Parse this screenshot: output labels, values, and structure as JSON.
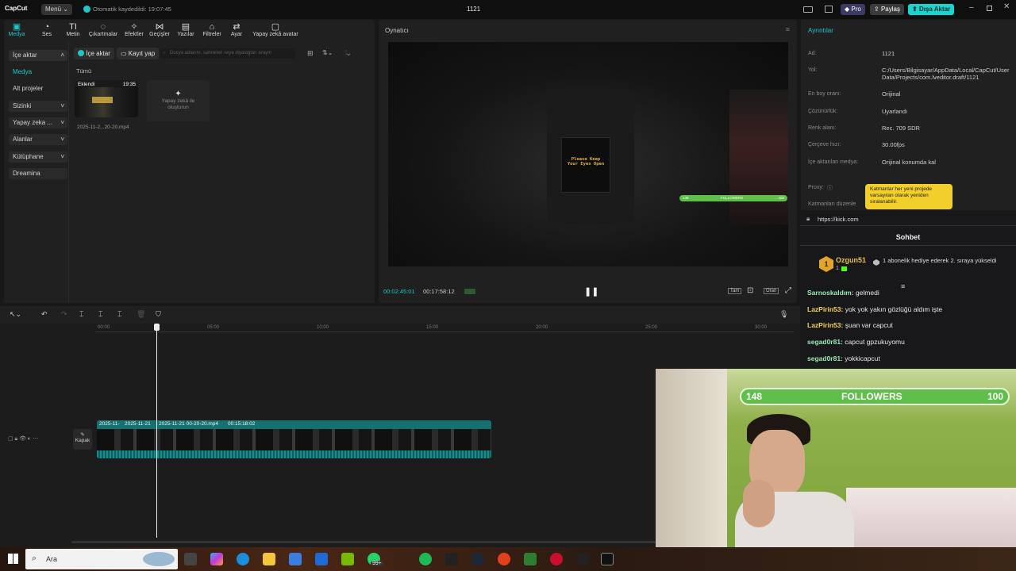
{
  "topbar": {
    "logo": "CapCut",
    "menu_label": "Menü",
    "autosave": "Otomatik kaydedildi: 19:07:45",
    "project_name": "1121",
    "pro_label": "Pro",
    "share_label": "Paylaş",
    "export_label": "Dışa Aktar"
  },
  "toolbar": {
    "items": [
      "Medya",
      "Ses",
      "Metin",
      "Çıkartmalar",
      "Efektler",
      "Geçişler",
      "Yazılar",
      "Filtreler",
      "Ayar",
      "Yapay zekâ avatar"
    ]
  },
  "leftnav": {
    "items": [
      "İçe aktar",
      "Medya",
      "Alt projeler",
      "Sizinki",
      "Yapay zeka ...",
      "Alanlar",
      "Kütüphane",
      "Dreamina"
    ]
  },
  "media": {
    "import_btn": "İçe aktar",
    "record_btn": "Kayıt yap",
    "search_placeholder": "Dosya adlarını, sahneleri veya diyalogları arayın",
    "filter_all": "Tümü",
    "clip_badge": "Eklendi",
    "clip_duration": "19:35",
    "clip_name": "2025-11-2...20-20.mp4",
    "ai_create": "Yapay zekâ ile oluşturun"
  },
  "player": {
    "title": "Oynatıcı",
    "sign_line1": "Please Keep",
    "sign_line2": "Your Eyes Open",
    "overlay_left": "148",
    "overlay_mid": "FOLLOWERS",
    "overlay_right": "100",
    "current_time": "00:02:45:01",
    "total_time": "00:17:58:12",
    "fit_label": "Tam",
    "ratio_label": "Oran"
  },
  "details": {
    "title": "Ayrıntılar",
    "rows": [
      {
        "k": "Ad:",
        "v": "1121"
      },
      {
        "k": "Yol:",
        "v": "C:/Users/Bilgisayar/AppData/Local/CapCut/User Data/Projects/com.lveditor.draft/1121"
      },
      {
        "k": "En boy oranı:",
        "v": "Orijinal"
      },
      {
        "k": "Çözünürlük:",
        "v": "Uyarlandı"
      },
      {
        "k": "Renk alanı:",
        "v": "Rec. 709 SDR"
      },
      {
        "k": "Çerçeve hızı:",
        "v": "30.00fps"
      },
      {
        "k": "İçe aktarılan medya:",
        "v": "Orijinal konumda kal"
      },
      {
        "k": "Proxy:",
        "v": ""
      },
      {
        "k": "Katmanları düzenle",
        "v": ""
      }
    ],
    "tooltip": "Katmanlar her yeni projede varsayılan olarak yeniden sıralanabilir."
  },
  "timeline": {
    "ruler": [
      "00:00",
      "05:00",
      "10:00",
      "15:00",
      "20:00",
      "25:00",
      "30:00"
    ],
    "cover_label": "Kapak",
    "clip_seg1": "2025-11-",
    "clip_seg2": "2025-11-21",
    "clip_main": "2025-11-21 00-20-20.mp4",
    "clip_main_dur": "00:15:18:02"
  },
  "chat": {
    "url": "https://kick.com",
    "title": "Sohbet",
    "pinned_user": "Ozgun51",
    "pinned_rank": "1",
    "pinned_count": "1",
    "pinned_text": "1 abonelik hediye ederek 2. sıraya yükseldi",
    "messages": [
      {
        "user": "Sarnoskaldım:",
        "text": "gelmedi"
      },
      {
        "user": "LazPirin53:",
        "text": "yok yok yakın gözlüğü aldım işte"
      },
      {
        "user": "LazPirin53:",
        "text": "şuan var capcut"
      },
      {
        "user": "segad0r81:",
        "text": "capcut gpzukuyomu"
      },
      {
        "user": "segad0r81:",
        "text": "yokkicapcut"
      }
    ]
  },
  "webcam": {
    "left": "148",
    "label": "FOLLOWERS",
    "right": "100"
  },
  "taskbar": {
    "search_placeholder": "Ara",
    "badge": "99+"
  },
  "colors": {
    "accent": "#1ec7c7",
    "export": "#1ad4d0",
    "pro": "#5b5bd6"
  }
}
